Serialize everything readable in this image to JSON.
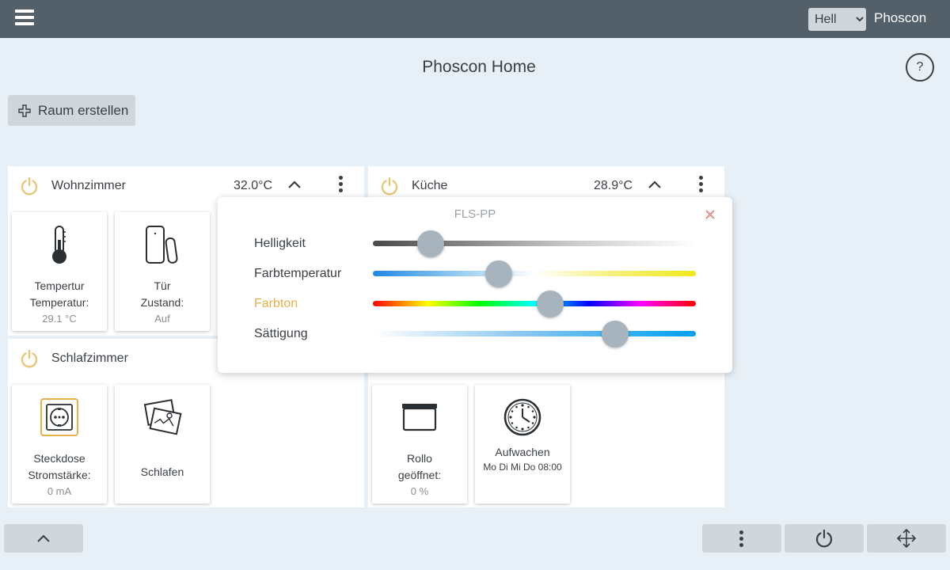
{
  "topbar": {
    "menu_icon": "hamburger-icon",
    "theme_selected": "Hell",
    "app_name": "Phoscon"
  },
  "page": {
    "title": "Phoscon Home",
    "help_label": "?"
  },
  "create_room": {
    "label": "Raum erstellen",
    "icon": "plus-icon"
  },
  "rooms": [
    {
      "name": "Wohnzimmer",
      "temperature": "32.0°C",
      "tiles": [
        {
          "icon": "thermometer-icon",
          "line1": "Tempertur",
          "line2": "Temperatur:",
          "line3": "29.1 °C"
        },
        {
          "icon": "door-sensor-icon",
          "line1": "Tür",
          "line2": "Zustand:",
          "line3": "Auf"
        }
      ]
    },
    {
      "name": "Küche",
      "temperature": "28.9°C",
      "tiles": [
        {
          "icon": "blind-icon",
          "line1": "Rollo",
          "line2": "geöffnet:",
          "line3": "0 %"
        },
        {
          "icon": "clock-icon",
          "line1": "Aufwachen",
          "line2": "Mo Di Mi Do 08:00"
        }
      ]
    },
    {
      "name": "Schlafzimmer",
      "tiles": [
        {
          "icon": "socket-icon",
          "line1": "Steckdose",
          "line2": "Stromstärke:",
          "line3": "0 mA"
        },
        {
          "icon": "scene-pictures-icon",
          "line1": "Schlafen"
        }
      ]
    }
  ],
  "popup": {
    "title": "FLS-PP",
    "close_icon": "close-x-icon",
    "sliders": [
      {
        "label": "Helligkeit",
        "value": 0.18,
        "active": false
      },
      {
        "label": "Farbtemperatur",
        "value": 0.39,
        "active": false
      },
      {
        "label": "Farbton",
        "value": 0.55,
        "active": true
      },
      {
        "label": "Sättigung",
        "value": 0.75,
        "active": false
      }
    ],
    "active_label_color": "#e8b04b"
  },
  "bottom_bar": {
    "collapse_icon": "chevron-up-icon",
    "more_icon": "kebab-menu-icon",
    "power_icon": "power-icon",
    "move_icon": "move-arrows-icon"
  },
  "colors": {
    "topbar": "#546069",
    "background": "#e8f0f7",
    "accent_power": "#e8c67a",
    "button": "#cfd6dc"
  }
}
